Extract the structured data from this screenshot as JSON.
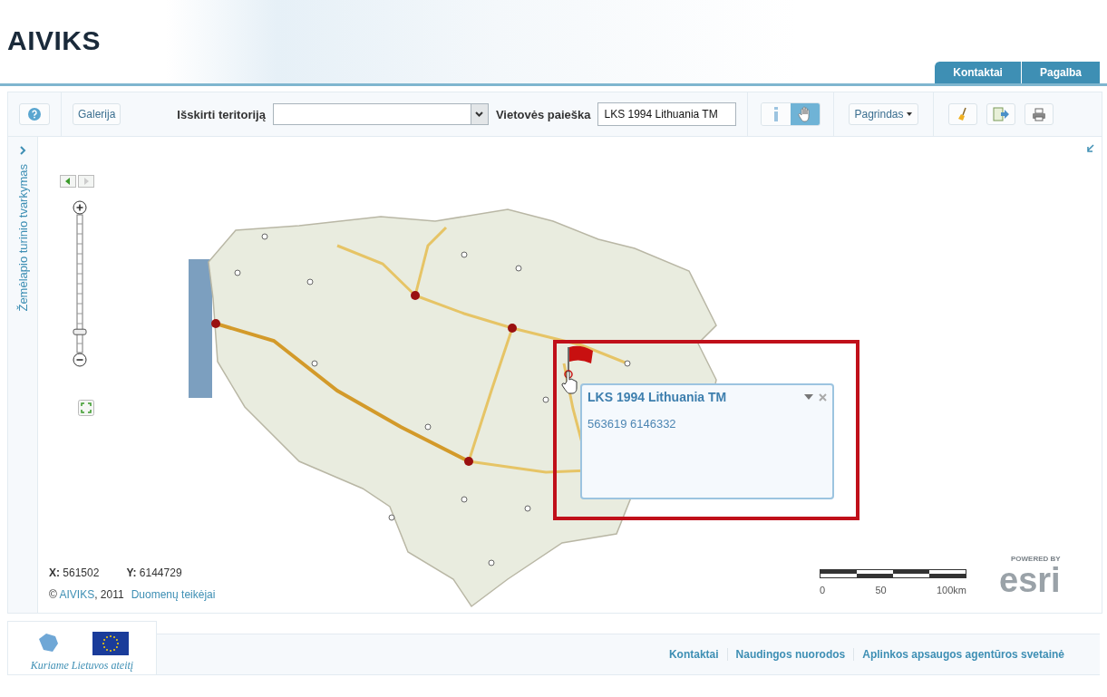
{
  "header": {
    "logo": "AIVIKS",
    "tabs": [
      {
        "label": "Kontaktai"
      },
      {
        "label": "Pagalba"
      }
    ]
  },
  "toolbar": {
    "gallery_button": "Galerija",
    "territory_label": "Išskirti teritoriją",
    "search_label": "Vietovės paieška",
    "search_value": "LKS 1994 Lithuania TM",
    "tools": [
      {
        "kind": "identify",
        "selected": false
      },
      {
        "kind": "pan",
        "selected": true
      }
    ],
    "basemap_button": "Pagrindas"
  },
  "side_panel": {
    "label": "Žemėlapio turinio tvarkymas",
    "expanded": false
  },
  "map": {
    "zoom_slider": {
      "level": 0.15
    },
    "popup": {
      "title": "LKS 1994 Lithuania TM",
      "text": "563619 6146332"
    },
    "coordinates": {
      "x_label": "X:",
      "x_value": "561502",
      "y_label": "Y:",
      "y_value": "6144729"
    },
    "copyright": {
      "symbol": "©",
      "owner": "AIVIKS",
      "year": ", 2011",
      "providers_link": "Duomenų teikėjai"
    },
    "scale_bar": {
      "labels": [
        "0",
        "50",
        "100km"
      ]
    },
    "esri_logo": {
      "powered_by": "POWERED BY",
      "name": "esri"
    }
  },
  "footer": {
    "slogan": "Kuriame Lietuvos ateitį",
    "links": [
      "Kontaktai",
      "Naudingos nuorodos",
      "Aplinkos apsaugos agentūros svetainė"
    ]
  }
}
